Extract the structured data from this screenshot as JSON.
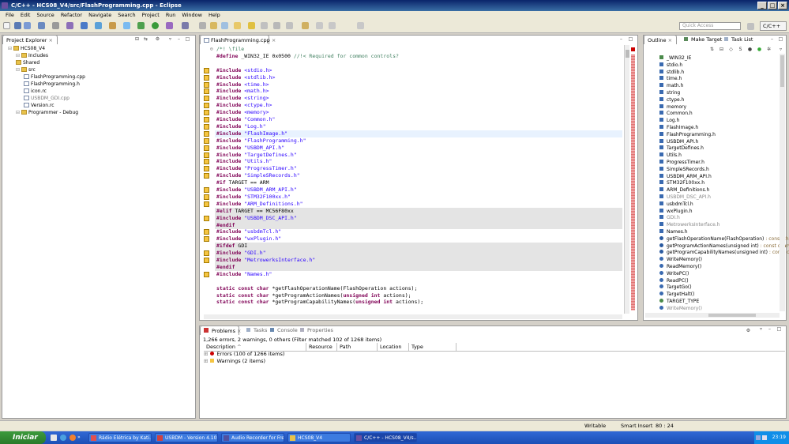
{
  "window": {
    "title": "C/C++ - HCS08_V4/src/FlashProgramming.cpp - Eclipse"
  },
  "menu": [
    "File",
    "Edit",
    "Source",
    "Refactor",
    "Navigate",
    "Search",
    "Project",
    "Run",
    "Window",
    "Help"
  ],
  "toolbar": {
    "quick_access_placeholder": "Quick Access",
    "perspective": "C/C++"
  },
  "project_explorer": {
    "tab": "Project Explorer",
    "items": [
      {
        "label": "HCS08_V4"
      },
      {
        "label": "Includes"
      },
      {
        "label": "Shared"
      },
      {
        "label": "src"
      },
      {
        "label": "FlashProgramming.cpp"
      },
      {
        "label": "FlashProgramming.h"
      },
      {
        "label": "icon.rc"
      },
      {
        "label": "USBDM_GDI.cpp"
      },
      {
        "label": "Version.rc"
      },
      {
        "label": "Programmer - Debug"
      }
    ]
  },
  "editor": {
    "tab": "FlashProgramming.cpp",
    "lines": [
      {
        "p": [
          "/*! \\file",
          "cmt"
        ]
      },
      {
        "segs": [
          [
            "#define ",
            "kw"
          ],
          [
            "_WIN32_IE 0x0500 ",
            ""
          ],
          [
            "//!< Required for common controls?",
            "cmt"
          ]
        ]
      },
      {
        "segs": []
      },
      {
        "segs": [
          [
            "#include ",
            "kw"
          ],
          [
            "<stdio.h>",
            "str"
          ]
        ]
      },
      {
        "segs": [
          [
            "#include ",
            "kw"
          ],
          [
            "<stdlib.h>",
            "str"
          ]
        ]
      },
      {
        "segs": [
          [
            "#include ",
            "kw"
          ],
          [
            "<time.h>",
            "str"
          ]
        ]
      },
      {
        "segs": [
          [
            "#include ",
            "kw"
          ],
          [
            "<math.h>",
            "str"
          ]
        ]
      },
      {
        "segs": [
          [
            "#include ",
            "kw"
          ],
          [
            "<string>",
            "str"
          ]
        ]
      },
      {
        "segs": [
          [
            "#include ",
            "kw"
          ],
          [
            "<ctype.h>",
            "str"
          ]
        ]
      },
      {
        "segs": [
          [
            "#include ",
            "kw"
          ],
          [
            "<memory>",
            "str"
          ]
        ]
      },
      {
        "segs": [
          [
            "#include ",
            "kw"
          ],
          [
            "\"Common.h\"",
            "str"
          ]
        ]
      },
      {
        "segs": [
          [
            "#include ",
            "kw"
          ],
          [
            "\"Log.h\"",
            "str"
          ]
        ]
      },
      {
        "segs": [
          [
            "#include ",
            "kw"
          ],
          [
            "\"FlashImage.h\"",
            "str"
          ]
        ]
      },
      {
        "segs": [
          [
            "#include ",
            "kw"
          ],
          [
            "\"FlashProgramming.h\"",
            "str"
          ]
        ]
      },
      {
        "segs": [
          [
            "#include ",
            "kw"
          ],
          [
            "\"USBDM_API.h\"",
            "str"
          ]
        ]
      },
      {
        "segs": [
          [
            "#include ",
            "kw"
          ],
          [
            "\"TargetDefines.h\"",
            "str"
          ]
        ]
      },
      {
        "segs": [
          [
            "#include ",
            "kw"
          ],
          [
            "\"Utils.h\"",
            "str"
          ]
        ]
      },
      {
        "segs": [
          [
            "#include ",
            "kw"
          ],
          [
            "\"ProgressTimer.h\"",
            "str"
          ]
        ]
      },
      {
        "segs": [
          [
            "#include ",
            "kw"
          ],
          [
            "\"SimpleSRecords.h\"",
            "str"
          ]
        ]
      },
      {
        "segs": [
          [
            "#if ",
            "kw"
          ],
          [
            "TARGET == ARM",
            ""
          ]
        ]
      },
      {
        "segs": [
          [
            "#include ",
            "kw"
          ],
          [
            "\"USBDM_ARM_API.h\"",
            "str"
          ]
        ]
      },
      {
        "segs": [
          [
            "#include ",
            "kw"
          ],
          [
            "\"STM32F100xx.h\"",
            "str"
          ]
        ]
      },
      {
        "segs": [
          [
            "#include ",
            "kw"
          ],
          [
            "\"ARM_Definitions.h\"",
            "str"
          ]
        ]
      },
      {
        "segs": [
          [
            "#elif ",
            "kw"
          ],
          [
            "TARGET == MC56F80xx",
            ""
          ]
        ]
      },
      {
        "segs": [
          [
            "#include ",
            "kw"
          ],
          [
            "\"USBDM_DSC_API.h\"",
            "str"
          ]
        ]
      },
      {
        "segs": [
          [
            "#endif",
            "kw"
          ]
        ]
      },
      {
        "segs": [
          [
            "#include ",
            "kw"
          ],
          [
            "\"usbdmTcl.h\"",
            "str"
          ]
        ]
      },
      {
        "segs": [
          [
            "#include ",
            "kw"
          ],
          [
            "\"wxPlugin.h\"",
            "str"
          ]
        ]
      },
      {
        "segs": [
          [
            "#ifdef ",
            "kw"
          ],
          [
            "GDI",
            ""
          ]
        ]
      },
      {
        "segs": [
          [
            "#include ",
            "kw"
          ],
          [
            "\"GDI.h\"",
            "str"
          ]
        ]
      },
      {
        "segs": [
          [
            "#include ",
            "kw"
          ],
          [
            "\"MetrowerksInterface.h\"",
            "str"
          ]
        ]
      },
      {
        "segs": [
          [
            "#endif",
            "kw"
          ]
        ]
      },
      {
        "segs": [
          [
            "#include ",
            "kw"
          ],
          [
            "\"Names.h\"",
            "str"
          ]
        ]
      },
      {
        "segs": []
      },
      {
        "segs": [
          [
            "static const char ",
            "kw"
          ],
          [
            "*getFlashOperationName(FlashOperation actions);",
            ""
          ]
        ]
      },
      {
        "segs": [
          [
            "static const char ",
            "kw"
          ],
          [
            "*getProgramActionNames(",
            ""
          ],
          [
            "unsigned int ",
            "kw"
          ],
          [
            "actions);",
            ""
          ]
        ]
      },
      {
        "segs": [
          [
            "static const char ",
            "kw"
          ],
          [
            "*getProgramCapabilityNames(",
            ""
          ],
          [
            "unsigned int ",
            "kw"
          ],
          [
            "actions);",
            ""
          ]
        ]
      }
    ]
  },
  "outline": {
    "tabs": [
      "Outline",
      "Make Target",
      "Task List"
    ],
    "items": [
      {
        "label": "_WIN32_IE",
        "type": ""
      },
      {
        "label": "stdio.h",
        "type": ""
      },
      {
        "label": "stdlib.h",
        "type": ""
      },
      {
        "label": "time.h",
        "type": ""
      },
      {
        "label": "math.h",
        "type": ""
      },
      {
        "label": "string",
        "type": ""
      },
      {
        "label": "ctype.h",
        "type": ""
      },
      {
        "label": "memory",
        "type": ""
      },
      {
        "label": "Common.h",
        "type": ""
      },
      {
        "label": "Log.h",
        "type": ""
      },
      {
        "label": "FlashImage.h",
        "type": ""
      },
      {
        "label": "FlashProgramming.h",
        "type": ""
      },
      {
        "label": "USBDM_API.h",
        "type": ""
      },
      {
        "label": "TargetDefines.h",
        "type": ""
      },
      {
        "label": "Utils.h",
        "type": ""
      },
      {
        "label": "ProgressTimer.h",
        "type": ""
      },
      {
        "label": "SimpleSRecords.h",
        "type": ""
      },
      {
        "label": "USBDM_ARM_API.h",
        "type": ""
      },
      {
        "label": "STM32F100xx.h",
        "type": ""
      },
      {
        "label": "ARM_Definitions.h",
        "type": ""
      },
      {
        "label": "USBDM_DSC_API.h",
        "type": ""
      },
      {
        "label": "usbdmTcl.h",
        "type": ""
      },
      {
        "label": "wxPlugin.h",
        "type": ""
      },
      {
        "label": "GDI.h",
        "type": ""
      },
      {
        "label": "MetrowerksInterface.h",
        "type": ""
      },
      {
        "label": "Names.h",
        "type": ""
      },
      {
        "label": "getFlashOperationName(FlashOperation)",
        "type": " : const char*"
      },
      {
        "label": "getProgramActionNames(unsigned int)",
        "type": " : const char*"
      },
      {
        "label": "getProgramCapabilityNames(unsigned int)",
        "type": " : const char*"
      },
      {
        "label": "WriteMemory()",
        "type": ""
      },
      {
        "label": "ReadMemory()",
        "type": ""
      },
      {
        "label": "WritePC()",
        "type": ""
      },
      {
        "label": "ReadPC()",
        "type": ""
      },
      {
        "label": "TargetGo()",
        "type": ""
      },
      {
        "label": "TargetHalt()",
        "type": ""
      },
      {
        "label": "TARGET_TYPE",
        "type": ""
      },
      {
        "label": "WriteMemory()",
        "type": ""
      }
    ]
  },
  "problems": {
    "tabs": [
      "Problems",
      "Tasks",
      "Console",
      "Properties"
    ],
    "summary": "1,266 errors, 2 warnings, 0 others (Filter matched 102 of 1268 items)",
    "columns": [
      "Description",
      "Resource",
      "Path",
      "Location",
      "Type"
    ],
    "rows": [
      "Errors (100 of 1266 items)",
      "Warnings (2 items)"
    ]
  },
  "status": {
    "mode": "Writable",
    "insert": "Smart Insert",
    "pos": "80 : 24"
  },
  "taskbar": {
    "start": "Iniciar",
    "tasks": [
      "Rádio Elétrica by Kati...",
      "USBDM - Version 4.10....",
      "Audio Recorder for Free",
      "HCS08_V4",
      "C/C++ - HCS08_V4/s..."
    ],
    "clock": "23:19"
  },
  "colors": {
    "keyword": "#7f0055",
    "string": "#2a00ff",
    "comment": "#3f7f5f",
    "error": "#cc0000",
    "warning": "#f5c542"
  }
}
